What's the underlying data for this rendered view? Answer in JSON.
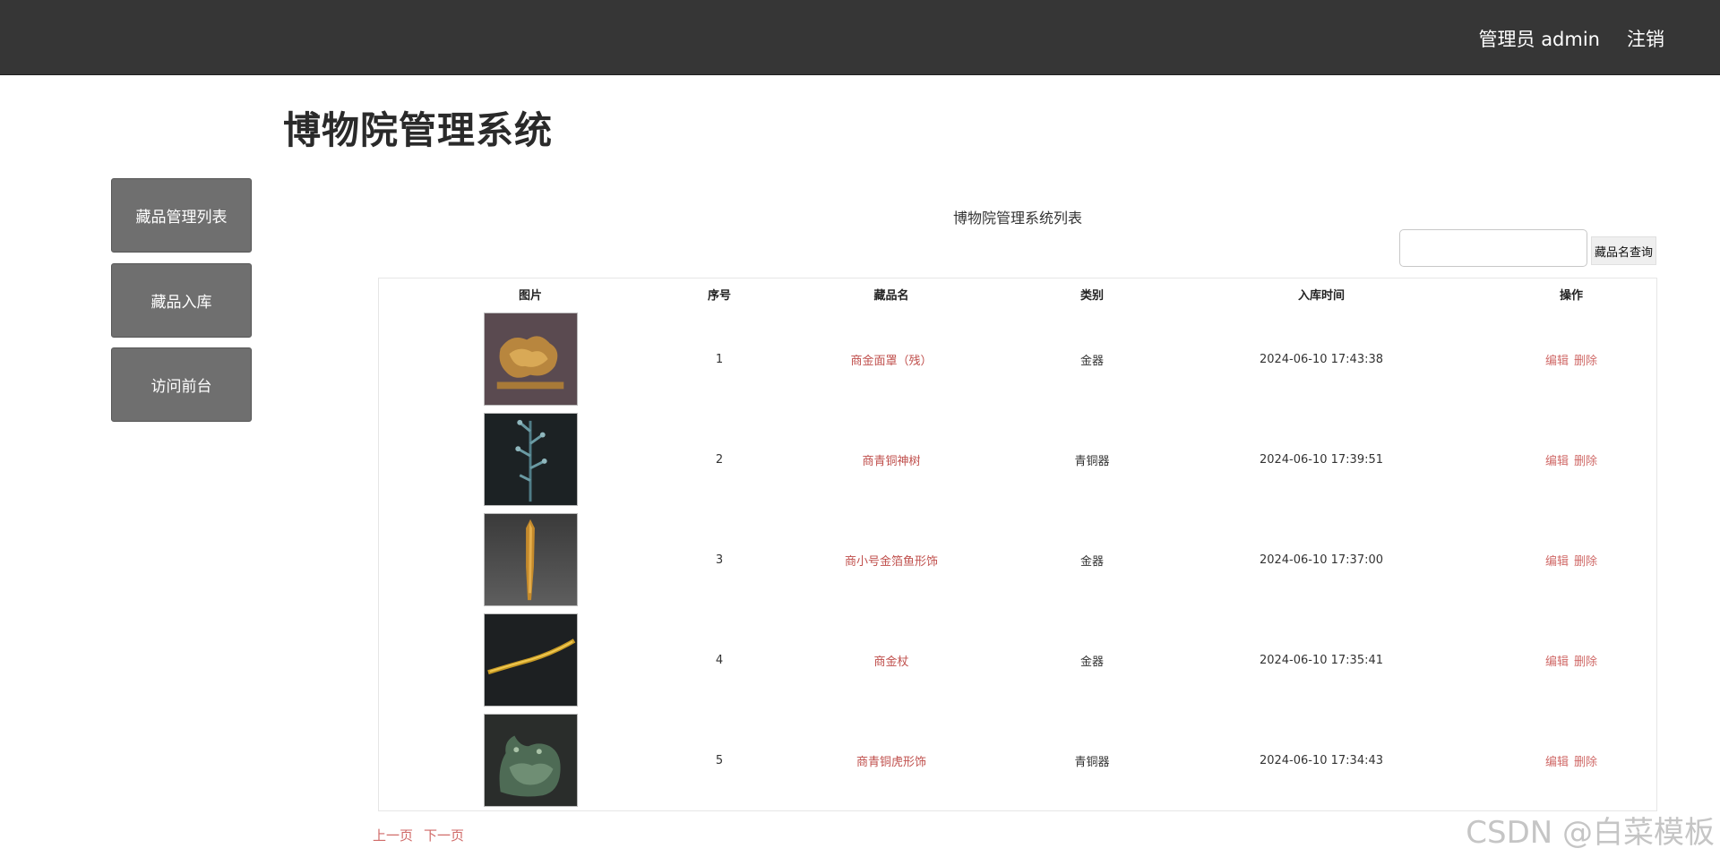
{
  "header": {
    "user_label": "管理员 admin",
    "logout_label": "注销"
  },
  "page_title": "博物院管理系统",
  "sidebar": {
    "items": [
      {
        "label": "藏品管理列表"
      },
      {
        "label": "藏品入库"
      },
      {
        "label": "访问前台"
      }
    ]
  },
  "list": {
    "caption": "博物院管理系统列表",
    "search_button": "藏品名查询",
    "search_value": "",
    "columns": [
      "图片",
      "序号",
      "藏品名",
      "类别",
      "入库时间",
      "操作"
    ],
    "rows": [
      {
        "index": "1",
        "name": "商金面罩（残）",
        "category": "金器",
        "time": "2024-06-10 17:43:38",
        "edit": "编辑",
        "delete": "删除"
      },
      {
        "index": "2",
        "name": "商青铜神树",
        "category": "青铜器",
        "time": "2024-06-10 17:39:51",
        "edit": "编辑",
        "delete": "删除"
      },
      {
        "index": "3",
        "name": "商小号金箔鱼形饰",
        "category": "金器",
        "time": "2024-06-10 17:37:00",
        "edit": "编辑",
        "delete": "删除"
      },
      {
        "index": "4",
        "name": "商金杖",
        "category": "金器",
        "time": "2024-06-10 17:35:41",
        "edit": "编辑",
        "delete": "删除"
      },
      {
        "index": "5",
        "name": "商青铜虎形饰",
        "category": "青铜器",
        "time": "2024-06-10 17:34:43",
        "edit": "编辑",
        "delete": "删除"
      }
    ]
  },
  "pager": {
    "prev": "上一页",
    "next": "下一页"
  },
  "watermark": "CSDN @白菜模板"
}
